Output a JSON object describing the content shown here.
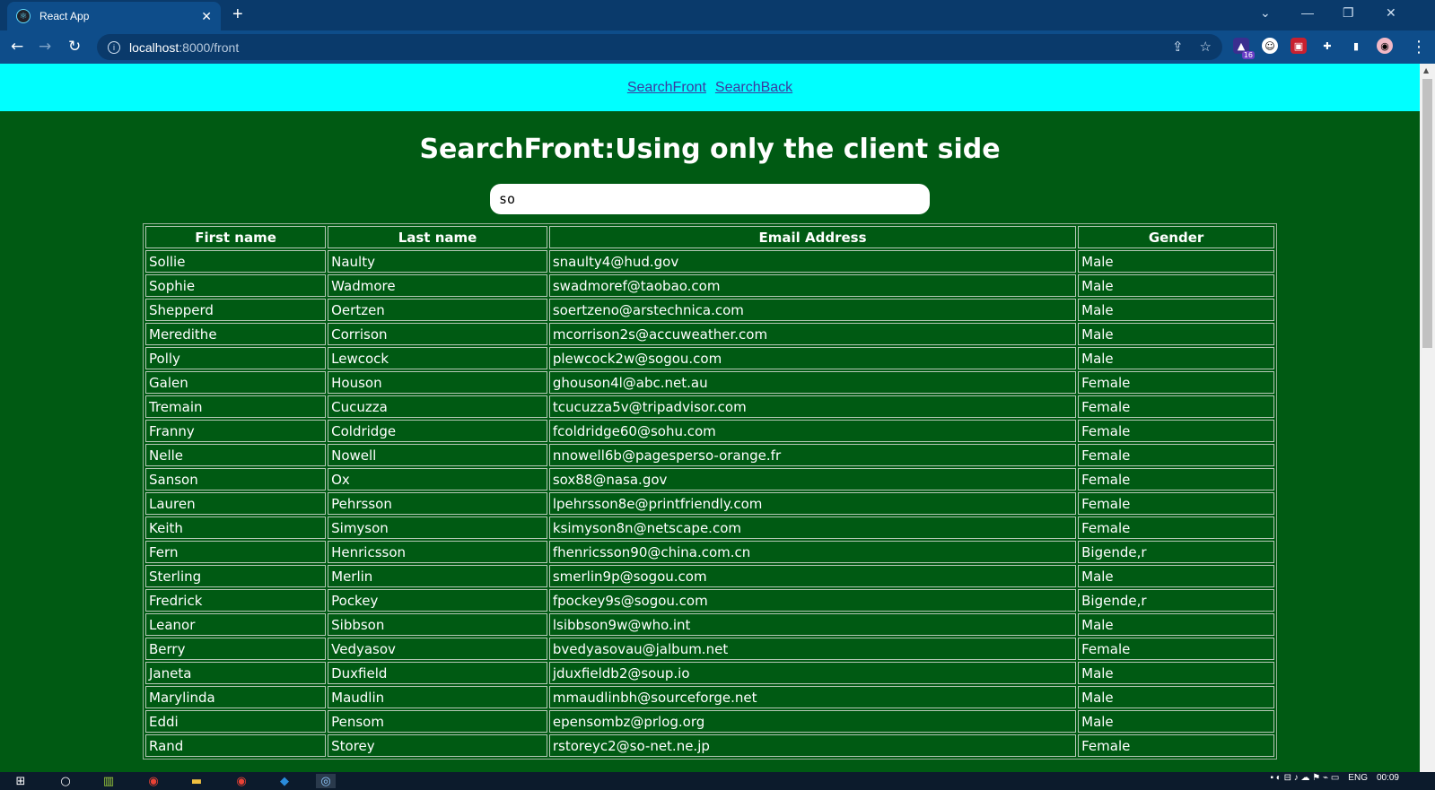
{
  "browser": {
    "tab_title": "React App",
    "url_host": "localhost",
    "url_path": ":8000/front",
    "extension_badge": "16",
    "window_controls": [
      "⌄",
      "—",
      "❐",
      "✕"
    ]
  },
  "navbar": {
    "links": [
      "SearchFront",
      "SearchBack"
    ]
  },
  "page": {
    "title": "SearchFront:Using only the client side",
    "search_value": "so"
  },
  "table": {
    "headers": [
      "First name",
      "Last name",
      "Email Address",
      "Gender"
    ],
    "rows": [
      [
        "Sollie",
        "Naulty",
        "snaulty4@hud.gov",
        "Male"
      ],
      [
        "Sophie",
        "Wadmore",
        "swadmoref@taobao.com",
        "Male"
      ],
      [
        "Shepperd",
        "Oertzen",
        "soertzeno@arstechnica.com",
        "Male"
      ],
      [
        "Meredithe",
        "Corrison",
        "mcorrison2s@accuweather.com",
        "Male"
      ],
      [
        "Polly",
        "Lewcock",
        "plewcock2w@sogou.com",
        "Male"
      ],
      [
        "Galen",
        "Houson",
        "ghouson4l@abc.net.au",
        "Female"
      ],
      [
        "Tremain",
        "Cucuzza",
        "tcucuzza5v@tripadvisor.com",
        "Female"
      ],
      [
        "Franny",
        "Coldridge",
        "fcoldridge60@sohu.com",
        "Female"
      ],
      [
        "Nelle",
        "Nowell",
        "nnowell6b@pagesperso-orange.fr",
        "Female"
      ],
      [
        "Sanson",
        "Ox",
        "sox88@nasa.gov",
        "Female"
      ],
      [
        "Lauren",
        "Pehrsson",
        "lpehrsson8e@printfriendly.com",
        "Female"
      ],
      [
        "Keith",
        "Simyson",
        "ksimyson8n@netscape.com",
        "Female"
      ],
      [
        "Fern",
        "Henricsson",
        "fhenricsson90@china.com.cn",
        "Bigende,r"
      ],
      [
        "Sterling",
        "Merlin",
        "smerlin9p@sogou.com",
        "Male"
      ],
      [
        "Fredrick",
        "Pockey",
        "fpockey9s@sogou.com",
        "Bigende,r"
      ],
      [
        "Leanor",
        "Sibbson",
        "lsibbson9w@who.int",
        "Male"
      ],
      [
        "Berry",
        "Vedyasov",
        "bvedyasovau@jalbum.net",
        "Female"
      ],
      [
        "Janeta",
        "Duxfield",
        "jduxfieldb2@soup.io",
        "Male"
      ],
      [
        "Marylinda",
        "Maudlin",
        "mmaudlinbh@sourceforge.net",
        "Male"
      ],
      [
        "Eddi",
        "Pensom",
        "epensombz@prlog.org",
        "Male"
      ],
      [
        "Rand",
        "Storey",
        "rstoreyc2@so-net.ne.jp",
        "Female"
      ]
    ]
  },
  "taskbar": {
    "language": "ENG",
    "time": "00:09"
  }
}
